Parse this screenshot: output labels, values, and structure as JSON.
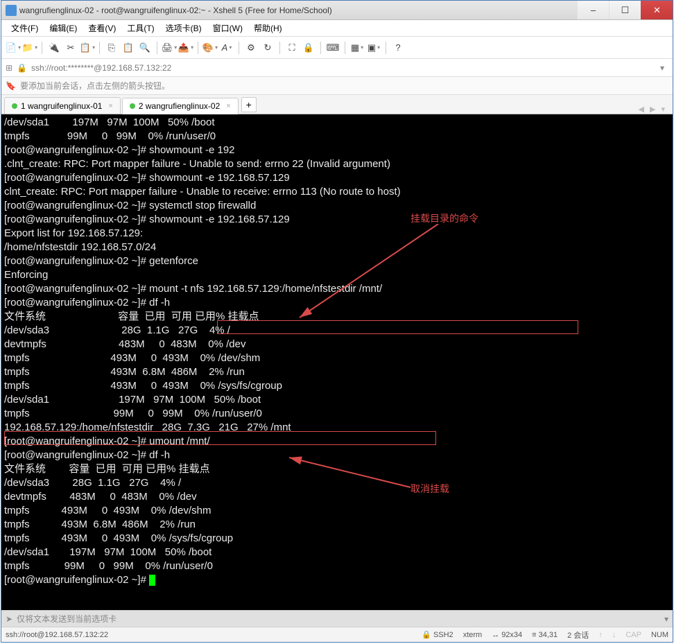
{
  "window": {
    "title": "wangrufienglinux-02 - root@wangruifenglinux-02:~ - Xshell 5 (Free for Home/School)"
  },
  "menu": {
    "file": "文件(F)",
    "edit": "编辑(E)",
    "view": "查看(V)",
    "tools": "工具(T)",
    "tabs": "选项卡(B)",
    "window": "窗口(W)",
    "help": "帮助(H)"
  },
  "address": {
    "text": "ssh://root:********@192.168.57.132:22"
  },
  "hint": {
    "text": "要添加当前会话，点击左侧的箭头按钮。"
  },
  "tabs": {
    "tab1": "1 wangruifenglinux-01",
    "tab2": "2 wangrufienglinux-02"
  },
  "terminal": {
    "lines": [
      "/dev/sda1        197M   97M  100M   50% /boot",
      "tmpfs             99M     0   99M    0% /run/user/0",
      "[root@wangruifenglinux-02 ~]# showmount -e 192",
      ".clnt_create: RPC: Port mapper failure - Unable to send: errno 22 (Invalid argument)",
      "[root@wangruifenglinux-02 ~]# showmount -e 192.168.57.129",
      "clnt_create: RPC: Port mapper failure - Unable to receive: errno 113 (No route to host)",
      "[root@wangruifenglinux-02 ~]# systemctl stop firewalld",
      "[root@wangruifenglinux-02 ~]# showmount -e 192.168.57.129",
      "Export list for 192.168.57.129:",
      "/home/nfstestdir 192.168.57.0/24",
      "[root@wangruifenglinux-02 ~]# getenforce",
      "Enforcing",
      "[root@wangruifenglinux-02 ~]# mount -t nfs 192.168.57.129:/home/nfstestdir /mnt/",
      "[root@wangruifenglinux-02 ~]# df -h",
      "文件系统                         容量  已用  可用 已用% 挂载点",
      "/dev/sda3                         28G  1.1G   27G    4% /",
      "devtmpfs                         483M     0  483M    0% /dev",
      "tmpfs                            493M     0  493M    0% /dev/shm",
      "tmpfs                            493M  6.8M  486M    2% /run",
      "tmpfs                            493M     0  493M    0% /sys/fs/cgroup",
      "/dev/sda1                        197M   97M  100M   50% /boot",
      "tmpfs                             99M     0   99M    0% /run/user/0",
      "192.168.57.129:/home/nfstestdir   28G  7.3G   21G   27% /mnt",
      "[root@wangruifenglinux-02 ~]# umount /mnt/",
      "[root@wangruifenglinux-02 ~]# df -h",
      "文件系统        容量  已用  可用 已用% 挂载点",
      "/dev/sda3        28G  1.1G   27G    4% /",
      "devtmpfs        483M     0  483M    0% /dev",
      "tmpfs           493M     0  493M    0% /dev/shm",
      "tmpfs           493M  6.8M  486M    2% /run",
      "tmpfs           493M     0  493M    0% /sys/fs/cgroup",
      "/dev/sda1       197M   97M  100M   50% /boot",
      "tmpfs            99M     0   99M    0% /run/user/0",
      "[root@wangruifenglinux-02 ~]# "
    ]
  },
  "annotations": {
    "a1": "挂载目录的命令",
    "a2": "取消挂载"
  },
  "sendbar": {
    "text": "仅将文本发送到当前选项卡"
  },
  "status": {
    "conn": "ssh://root@192.168.57.132:22",
    "ssh": "SSH2",
    "term": "xterm",
    "size": "92x34",
    "pos": "34,31",
    "sess": "2 会话",
    "cap": "CAP",
    "num": "NUM"
  }
}
